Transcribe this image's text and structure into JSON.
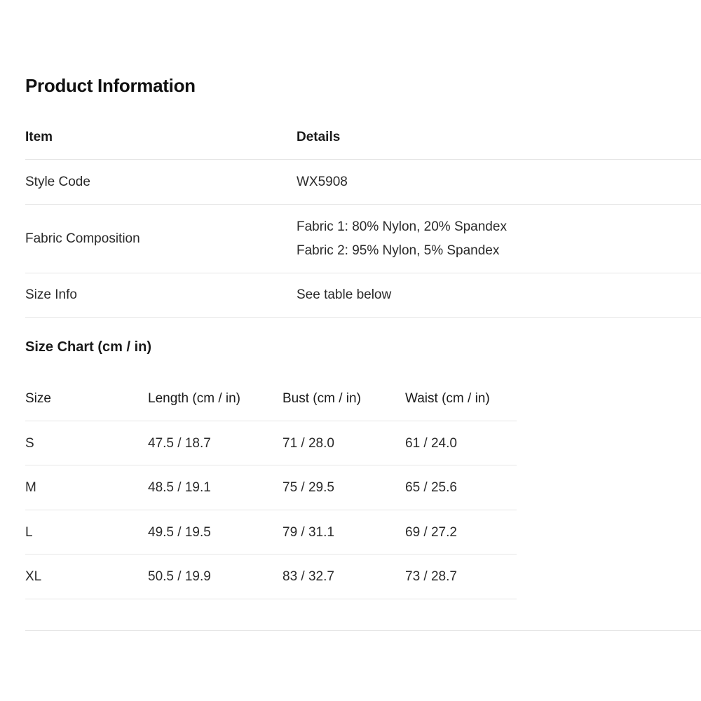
{
  "title": "Product Information",
  "info": {
    "headers": {
      "item": "Item",
      "details": "Details"
    },
    "rows": [
      {
        "label": "Style Code",
        "lines": [
          "WX5908"
        ]
      },
      {
        "label": "Fabric Composition",
        "lines": [
          "Fabric 1: 80% Nylon, 20% Spandex",
          "Fabric 2: 95% Nylon, 5% Spandex"
        ]
      },
      {
        "label": "Size Info",
        "lines": [
          "See table below"
        ]
      }
    ]
  },
  "size_chart": {
    "title": "Size Chart (cm / in)",
    "headers": [
      "Size",
      "Length (cm / in)",
      "Bust (cm / in)",
      "Waist (cm / in)"
    ],
    "rows": [
      [
        "S",
        "47.5 / 18.7",
        "71 / 28.0",
        "61 / 24.0"
      ],
      [
        "M",
        "48.5 / 19.1",
        "75 / 29.5",
        "65 / 25.6"
      ],
      [
        "L",
        "49.5 / 19.5",
        "79 / 31.1",
        "69 / 27.2"
      ],
      [
        "XL",
        "50.5 / 19.9",
        "83 / 32.7",
        "73 / 28.7"
      ]
    ]
  }
}
